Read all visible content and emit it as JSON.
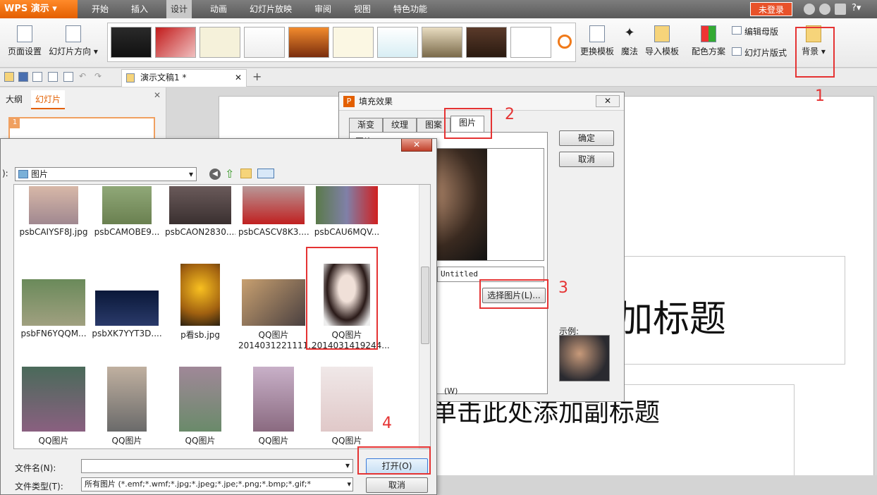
{
  "app": {
    "title": "WPS 演示",
    "login": "未登录",
    "help": "?"
  },
  "menu": [
    "开始",
    "插入",
    "设计",
    "动画",
    "幻灯片放映",
    "审阅",
    "视图",
    "特色功能"
  ],
  "ribbon": {
    "page_setup": "页面设置",
    "orientation": "幻灯片方向",
    "change_template": "更换模板",
    "magic": "魔法",
    "import_template": "导入模板",
    "color_scheme": "配色方案",
    "edit_master": "编辑母版",
    "slide_layout": "幻灯片版式",
    "background": "背景"
  },
  "tabs": {
    "doc": "演示文稿1 *",
    "outline": "大纲",
    "slides": "幻灯片",
    "slide_num": "1"
  },
  "slide": {
    "title_fragment": "加标题",
    "subtitle_fragment": "单击此处添加副标题"
  },
  "fill_dialog": {
    "title": "填充效果",
    "tabs": [
      "渐变",
      "纹理",
      "图案",
      "图片"
    ],
    "picture_label": "图片:",
    "filename": "Untitled",
    "choose_button": "选择图片(L)...",
    "ok": "确定",
    "cancel": "取消",
    "sample_label": "示例:",
    "lock_fragment": "(W)"
  },
  "file_dialog": {
    "location_label": "):",
    "location": "图片",
    "files_row1": [
      "psbCAIYSF8J.jpg",
      "psbCAMOBE9...",
      "psbCAON2830....",
      "psbCASCV8K3....",
      "psbCAU6MQV..."
    ],
    "files_row2": [
      {
        "line1": "psbFN6YQQM...",
        "line2": ""
      },
      {
        "line1": "psbXK7YYT3D....",
        "line2": ""
      },
      {
        "line1": "p看sb.jpg",
        "line2": ""
      },
      {
        "line1": "QQ图片",
        "line2": "2014031221111..."
      },
      {
        "line1": "QQ图片",
        "line2": "2014031419244..."
      }
    ],
    "files_row3": [
      "QQ图片",
      "QQ图片",
      "QQ图片",
      "QQ图片",
      "QQ图片"
    ],
    "filename_label": "文件名(N):",
    "filename_value": "",
    "filetype_label": "文件类型(T):",
    "filetype_value": "所有图片 (*.emf;*.wmf;*.jpg;*.jpeg;*.jpe;*.png;*.bmp;*.gif;*",
    "open": "打开(O)",
    "cancel": "取消"
  },
  "annotations": [
    "1",
    "2",
    "3",
    "4"
  ],
  "colors": {
    "accent": "#e35f00",
    "annotation": "#e53333",
    "menubar": "#6a6a6a"
  }
}
